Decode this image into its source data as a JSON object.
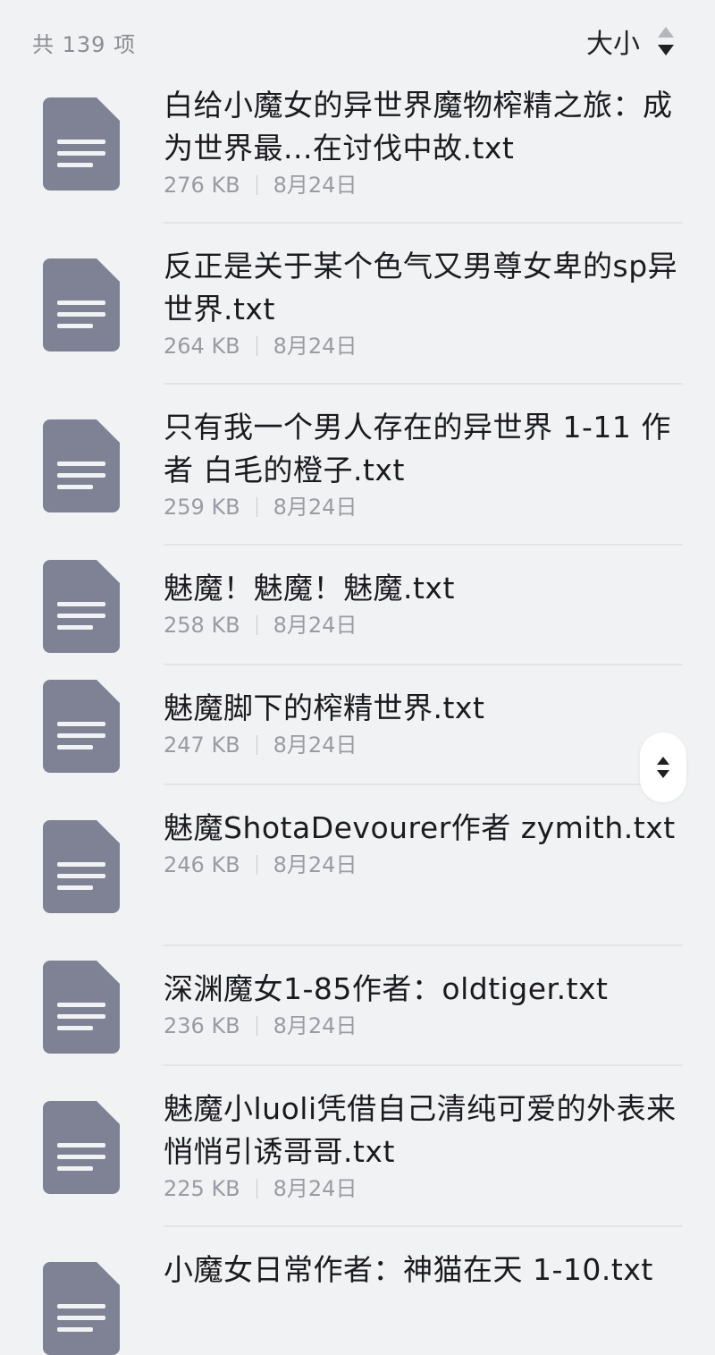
{
  "header": {
    "count_text": "共 139 项",
    "sort_label": "大小",
    "sort_icon": "sort-up-down-icon"
  },
  "files": [
    {
      "name": "白给小魔女的异世界魔物榨精之旅：成为世界最...在讨伐中故.txt",
      "size": "276 KB",
      "date": "8月24日"
    },
    {
      "name": "反正是关于某个色气又男尊女卑的sp异世界.txt",
      "size": "264 KB",
      "date": "8月24日"
    },
    {
      "name": "只有我一个男人存在的异世界 1-11 作者 白毛的橙子.txt",
      "size": "259 KB",
      "date": "8月24日"
    },
    {
      "name": "魅魔！魅魔！魅魔.txt",
      "size": "258 KB",
      "date": "8月24日"
    },
    {
      "name": "魅魔脚下的榨精世界.txt",
      "size": "247 KB",
      "date": "8月24日"
    },
    {
      "name": "魅魔ShotaDevourer作者 zymith.txt",
      "size": "246 KB",
      "date": "8月24日"
    },
    {
      "name": "深渊魔女1-85作者：oldtiger.txt",
      "size": "236 KB",
      "date": "8月24日"
    },
    {
      "name": "魅魔小luoli凭借自己清纯可爱的外表来悄悄引诱哥哥.txt",
      "size": "225 KB",
      "date": "8月24日"
    },
    {
      "name": "小魔女日常作者：神猫在天 1-10.txt",
      "size": "",
      "date": ""
    }
  ],
  "colors": {
    "background": "#f1f2f4",
    "icon_fill": "#7e8294",
    "text_primary": "#1b1b1f",
    "text_secondary": "#9a9ca3"
  },
  "icons": {
    "file": "text-document-icon",
    "scroll": "fast-scroll-handle-icon"
  }
}
